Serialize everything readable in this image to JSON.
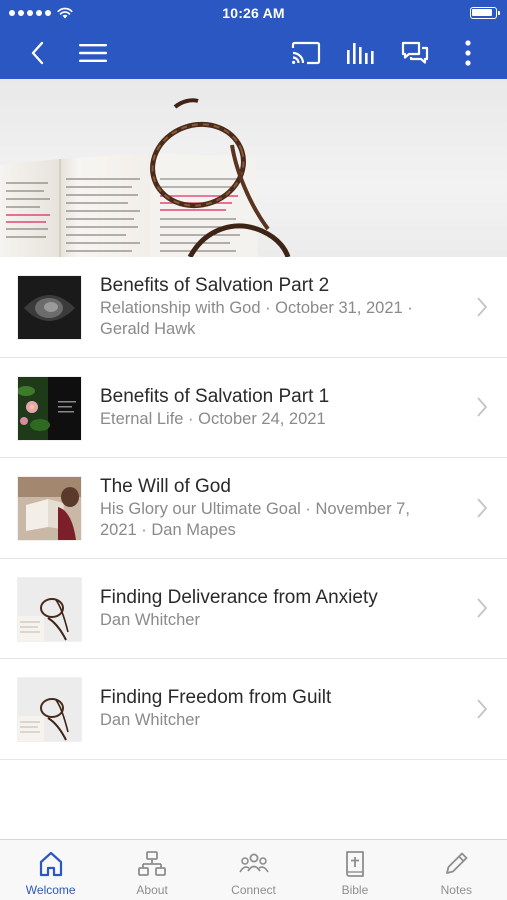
{
  "status_bar": {
    "time": "10:26 AM"
  },
  "nav": {
    "icons": [
      "back-icon",
      "menu-icon",
      "cast-icon",
      "stats-icon",
      "chat-icon",
      "more-icon"
    ]
  },
  "colors": {
    "brand": "#2b57c3",
    "tab_active": "#2b57c3",
    "tab_inactive": "#8e8e8e"
  },
  "sermons": [
    {
      "title": "Benefits of Salvation Part 2",
      "line1": "Relationship with God · October 31, 2021 ·",
      "line2": "Gerald Hawk"
    },
    {
      "title": "Benefits of Salvation Part 1",
      "line1": "Eternal Life · October 24, 2021",
      "line2": ""
    },
    {
      "title": "The Will of God",
      "line1": "His Glory our Ultimate Goal · November 7,",
      "line2": "2021 · Dan Mapes"
    },
    {
      "title": "Finding Deliverance from Anxiety",
      "line1": "Dan Whitcher",
      "line2": ""
    },
    {
      "title": "Finding Freedom from Guilt",
      "line1": "Dan Whitcher",
      "line2": ""
    }
  ],
  "tabs": [
    {
      "label": "Welcome",
      "icon": "home-icon",
      "active": true
    },
    {
      "label": "About",
      "icon": "org-chart-icon",
      "active": false
    },
    {
      "label": "Connect",
      "icon": "people-icon",
      "active": false
    },
    {
      "label": "Bible",
      "icon": "bible-icon",
      "active": false
    },
    {
      "label": "Notes",
      "icon": "pencil-icon",
      "active": false
    }
  ]
}
